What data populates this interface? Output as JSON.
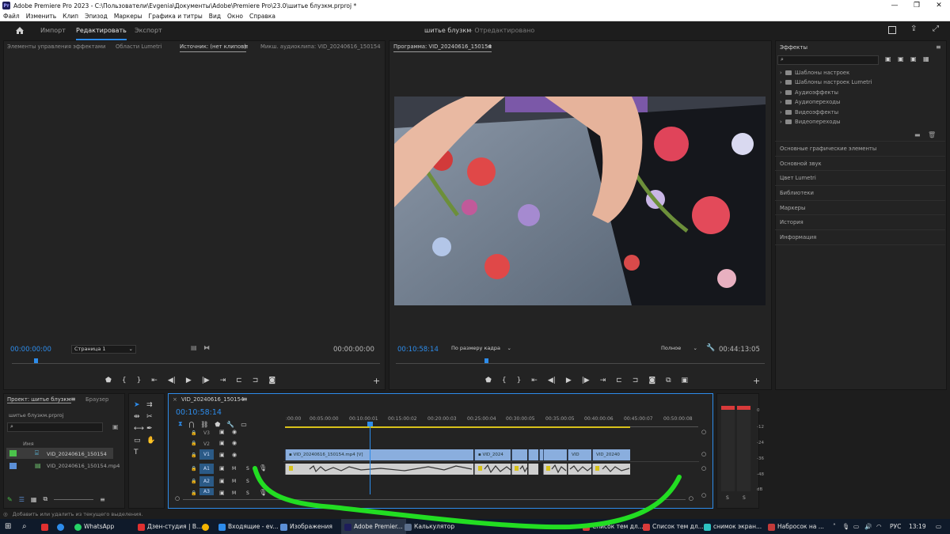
{
  "app": {
    "title": "Adobe Premiere Pro 2023 - C:\\Пользователи\\Evgenia\\Документы\\Adobe\\Premiere Pro\\23.0\\шитье блузкм.prproj *",
    "logo": "Pr"
  },
  "menu": [
    "Файл",
    "Изменить",
    "Клип",
    "Эпизод",
    "Маркеры",
    "Графика и титры",
    "Вид",
    "Окно",
    "Справка"
  ],
  "header": {
    "tabs": [
      "Импорт",
      "Редактировать",
      "Экспорт"
    ],
    "active_tab": "Редактировать",
    "project_title": "шитье блузкм",
    "project_status": "- Отредактировано"
  },
  "source_panel": {
    "tabs": [
      "Элементы управления эффектами",
      "Области Lumetri",
      "Источник: (нет клипов)",
      "Микш. аудиоклипа: VID_20240616_150154"
    ],
    "timecode_in": "00:00:00:00",
    "page_select": "Страница 1",
    "timecode_out": "00:00:00:00"
  },
  "program_panel": {
    "tab": "Программа: VID_20240616_150154",
    "timecode": "00:10:58:14",
    "fit": "По размеру кадра",
    "quality": "Полное",
    "duration": "00:44:13:05"
  },
  "effects_panel": {
    "title": "Эффекты",
    "tree": [
      "Шаблоны настроек",
      "Шаблоны настроек Lumetri",
      "Аудиоэффекты",
      "Аудиопереходы",
      "Видеоэффекты",
      "Видеопереходы"
    ],
    "sections": [
      "Основные графические элементы",
      "Основной звук",
      "Цвет Lumetri",
      "Библиотеки",
      "Маркеры",
      "История",
      "Информация"
    ]
  },
  "project_panel": {
    "tabs": [
      "Проект: шитье блузкм",
      "Браузер"
    ],
    "file": "шитье блузкм.prproj",
    "column": "Имя",
    "items": [
      "VID_20240616_150154",
      "VID_20240616_150154.mp4"
    ]
  },
  "timeline": {
    "sequence": "VID_20240616_150154",
    "timecode": "00:10:58:14",
    "ruler": [
      ":00:00",
      "00:05:00:00",
      "00:10:00:01",
      "00:15:00:02",
      "00:20:00:03",
      "00:25:00:04",
      "00:30:00:05",
      "00:35:00:05",
      "00:40:00:06",
      "00:45:00:07",
      "00:50:00:08"
    ],
    "video_tracks": [
      "V3",
      "V2",
      "V1"
    ],
    "audio_tracks": [
      "A1",
      "A2",
      "A3"
    ],
    "clips": [
      "VID_20240616_150154.mp4 [V]",
      "VID_2024",
      "VID",
      "VID_20240"
    ],
    "track_buttons": {
      "mute": "M",
      "solo": "S"
    }
  },
  "meter": {
    "scale": [
      "0",
      "-12",
      "-24",
      "-36",
      "-48",
      "dB"
    ],
    "solo": "S"
  },
  "status_bar": {
    "text": "Добавить или удалить из текущего выделения."
  },
  "taskbar": {
    "items": [
      "WhatsApp",
      "Дзен-студия | В...",
      "Входящие - ev...",
      "Изображения",
      "Adobe Premier...",
      "Калькулятор",
      "Список тем дл...",
      "Список тем дл...",
      "снимок экран...",
      "Набросок на ..."
    ],
    "lang": "РУС",
    "time": "13:19"
  },
  "colors": {
    "accent": "#2d8ceb",
    "video_clip": "#8aaede",
    "audio_clip": "#cfcfcf",
    "annotation": "#22dd22"
  }
}
